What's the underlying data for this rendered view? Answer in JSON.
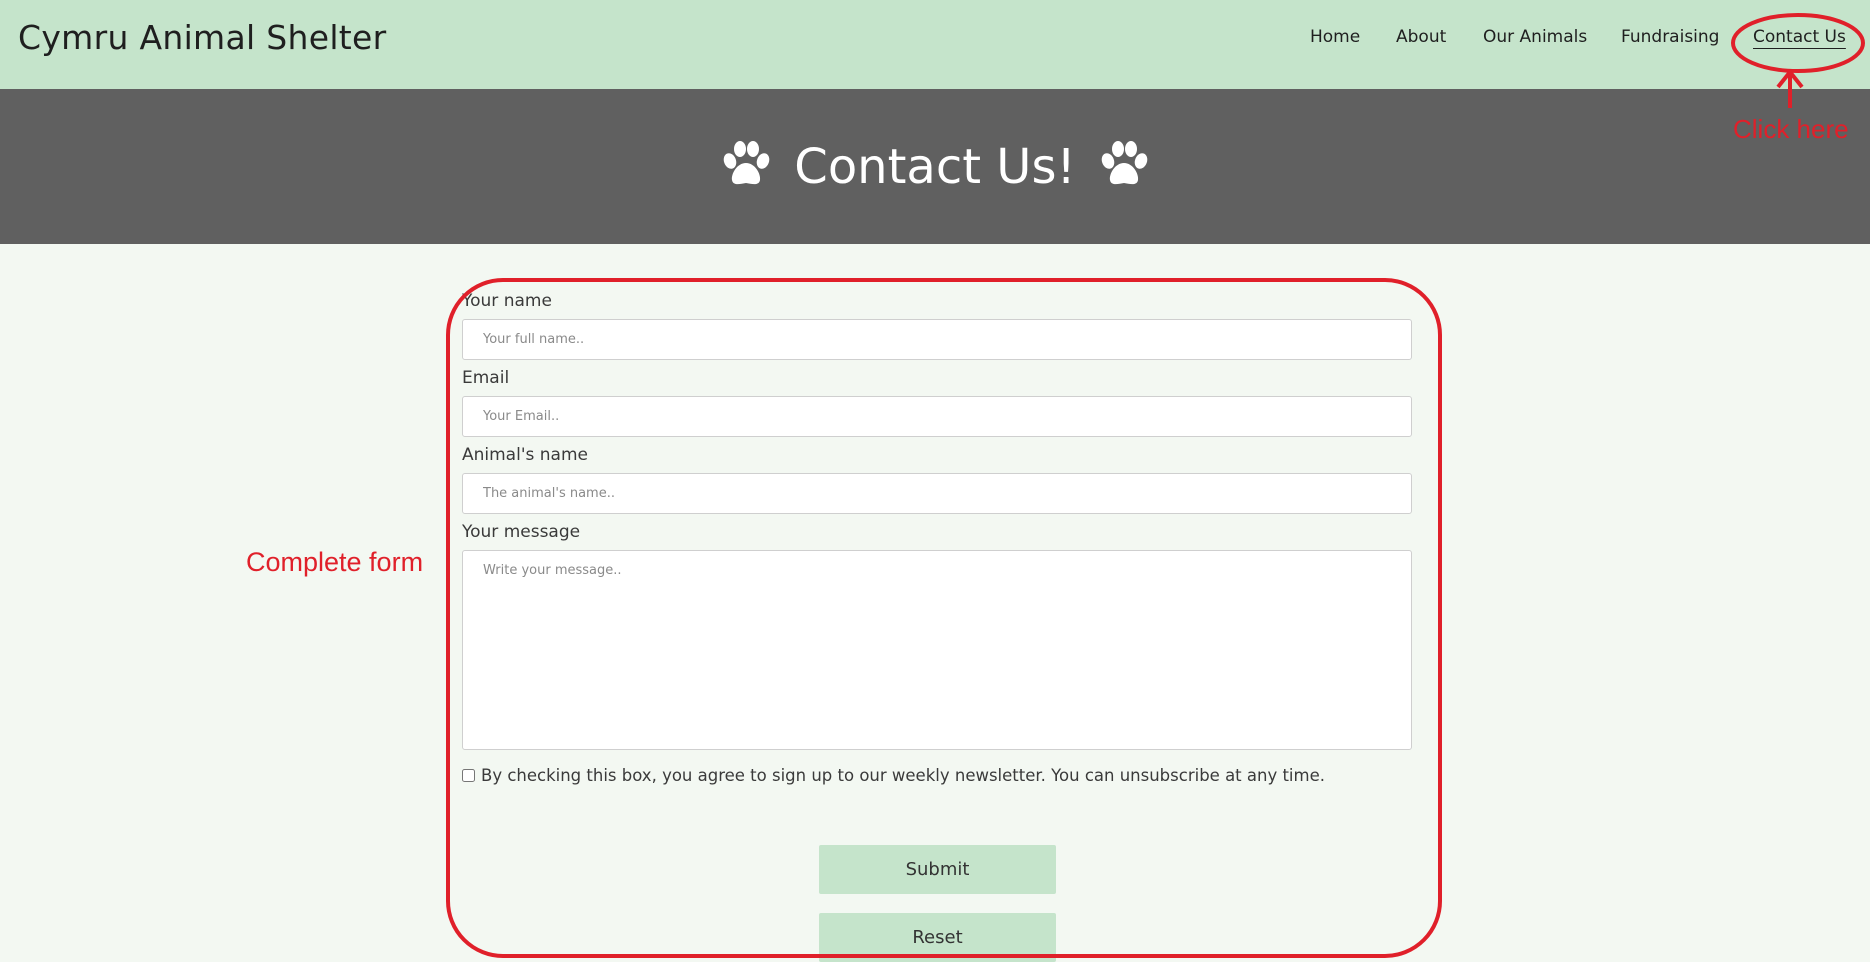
{
  "header": {
    "brand": "Cymru Animal Shelter",
    "nav": [
      {
        "label": "Home"
      },
      {
        "label": "About"
      },
      {
        "label": "Our Animals"
      },
      {
        "label": "Fundraising"
      },
      {
        "label": "Contact Us",
        "active": true
      }
    ]
  },
  "hero": {
    "title": "Contact Us!",
    "left_icon": "paw-icon",
    "right_icon": "paw-icon"
  },
  "form": {
    "name": {
      "label": "Your name",
      "placeholder": "Your full name.."
    },
    "email": {
      "label": "Email",
      "placeholder": "Your Email.."
    },
    "animal": {
      "label": "Animal's name",
      "placeholder": "The animal's name.."
    },
    "message": {
      "label": "Your message",
      "placeholder": "Write your message.."
    },
    "newsletter": {
      "label": "By checking this box, you agree to sign up to our weekly newsletter. You can unsubscribe at any time.",
      "checked": false
    },
    "submit_label": "Submit",
    "reset_label": "Reset"
  },
  "annotations": {
    "nav_hint": "Click here",
    "form_hint": "Complete form"
  },
  "colors": {
    "header_bg": "#c5e4cb",
    "hero_bg": "#606060",
    "page_bg": "#f3f8f2",
    "annotation": "#e0202a"
  }
}
